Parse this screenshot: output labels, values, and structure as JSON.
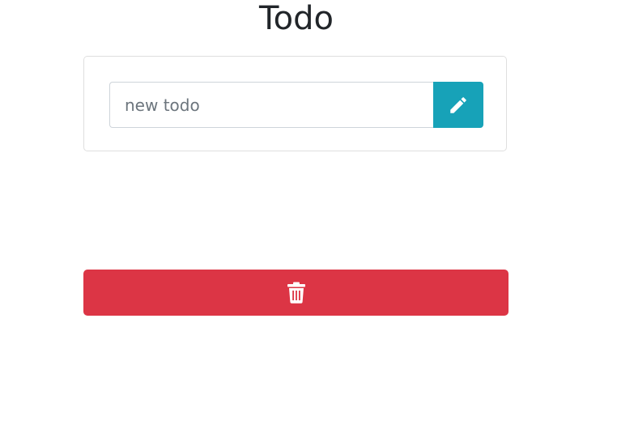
{
  "header": {
    "title": "Todo"
  },
  "new_todo": {
    "placeholder": "new todo",
    "value": "",
    "submit_icon": "pencil-icon"
  },
  "actions": {
    "delete_all_icon": "trash-icon"
  },
  "colors": {
    "info": "#17a2b8",
    "danger": "#dc3545",
    "text": "#212529"
  }
}
